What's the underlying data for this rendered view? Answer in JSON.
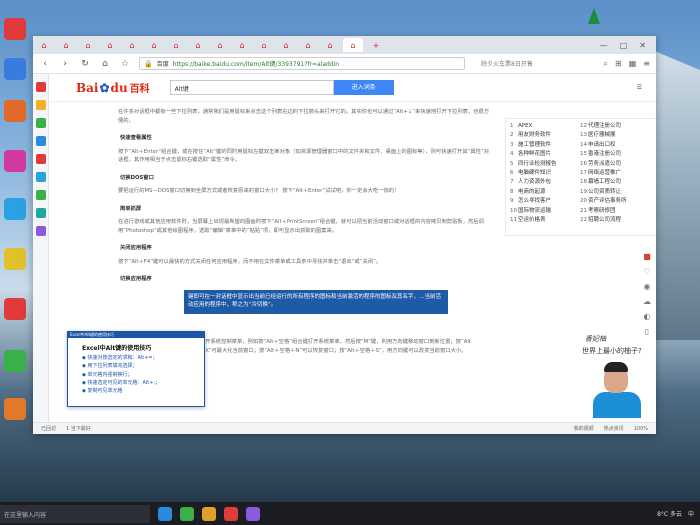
{
  "browser": {
    "tabs": [
      "",
      "",
      "",
      "",
      "",
      "",
      "",
      "",
      "",
      "",
      "",
      "",
      "",
      "",
      "",
      "",
      ""
    ],
    "new_tab": "+",
    "url_prefix": "百度",
    "url": "https://baike.baidu.com/item/Alt键/3393791?fr=aladdin",
    "recommend_text": "除夕火车票8日开售",
    "window_controls": [
      "—",
      "□",
      "✕"
    ]
  },
  "baike": {
    "logo_text": "Bai",
    "logo_paw": "du",
    "logo_suffix": "百科",
    "search_value": "Alt键",
    "search_button": "进入词条",
    "user_icon": "☰"
  },
  "article": {
    "p1": "在许多对话框中都有一些下拉列表，通常我们是用鼠标来点击这个列表右边的下拉箭头来打开它的。其实你也可以通过“Alt+↓”来快速地打开下拉列表，也很方便的。",
    "h1": "快速查看属性",
    "p2": "按下“Alt＋Enter”组合键，或在按住“Alt”键的同时用鼠标左键双击某对象（如资源管理器窗口中的文件夹和文件、桌面上的图标等），则可快速打开其“属性”对话框，其作用相当于点击鼠标右键选取“属性”命令。",
    "h2": "切换DOS窗口",
    "p3": "要把运行的MS－DOS窗口切换到全屏方式或者恢复原来的窗口大小？ 按下“Alt＋Enter”试试吧，你一定会大吃一惊的！",
    "h3": "简单抓屏",
    "p4": "在进行游戏或其他应用软件时，当屏幕上出现最希望的图画时按下“Alt＋PrintScreen”组合键，就可以把当前活动窗口或对话框的内容拷贝到剪贴板，然后调用“Photoshop”或其他绘图程序，选取“编辑”菜单中的“粘贴”项，即可显示出抓取的图案来。",
    "h4": "关闭应用程序",
    "p5": "按下“Alt＋F4”键可以最快的方式关闭任何应用程序，而不用在文件菜单或工具条中寻找并单击“退出”或“关闭”。",
    "h5": "切换应用程序",
    "p6_highlight": "键即可在一对话框中显示出当前已经运行的所有程序的图标和当前激活的程序的图标及其名字，…当前活动应用的程序中，称之为“冷切换”。",
    "p7": "以直接打开系统控制菜单，例如按“Alt＋空格”组合键打开系统菜单，然后按“M”键，利用方向键移动窗口到新位置；按“Alt＋空格＋X”可最大化当前窗口；按“Alt＋空格＋N”可以恢复窗口；按“Alt＋空格＋S”，用方向键可以改变当前窗口大小。"
  },
  "sidebar": {
    "items": [
      {
        "num": "1",
        "label": "APEX"
      },
      {
        "num": "12",
        "label": "代理注册公司"
      },
      {
        "num": "2",
        "label": "用友财务软件"
      },
      {
        "num": "13",
        "label": "医疗器械展"
      },
      {
        "num": "3",
        "label": "施工管理软件"
      },
      {
        "num": "14",
        "label": "申请出口权"
      },
      {
        "num": "4",
        "label": "各种鲜花图片"
      },
      {
        "num": "15",
        "label": "香港注册公司"
      },
      {
        "num": "5",
        "label": "同行业检测报告"
      },
      {
        "num": "16",
        "label": "劳务派遣公司"
      },
      {
        "num": "6",
        "label": "电脑硬件知识"
      },
      {
        "num": "17",
        "label": "网络运营推广"
      },
      {
        "num": "7",
        "label": "人力资源外包"
      },
      {
        "num": "18",
        "label": "幕墙工程公司"
      },
      {
        "num": "8",
        "label": "电商的起源"
      },
      {
        "num": "19",
        "label": "公司资质转让"
      },
      {
        "num": "9",
        "label": "怎么寻找客户"
      },
      {
        "num": "20",
        "label": "资产评估事务所"
      },
      {
        "num": "10",
        "label": "国际物流运输"
      },
      {
        "num": "21",
        "label": "考察研修团"
      },
      {
        "num": "11",
        "label": "空运价格表"
      },
      {
        "num": "22",
        "label": "招聘公司流程"
      }
    ]
  },
  "popup": {
    "bar": "Excel中Alt键的使用技巧",
    "title": "Excel中Alt键的使用技巧",
    "items": [
      "快速对按选定的求和：Alt+=；",
      "用下拉列表填充选择；",
      "单元格内强制换行；",
      "快速选定可见的单元格：Alt+;；",
      "复制可见单元格"
    ]
  },
  "presenter": {
    "name": "香妃柚",
    "subtitle": "世界上最小的柚子?"
  },
  "statusbar": {
    "items": [
      "已回访",
      "1 当下最好"
    ],
    "right_items": [
      "我的视频",
      "热点资讯",
      "",
      "100%"
    ]
  },
  "taskbar": {
    "search_placeholder": "在这里输入内容",
    "weather": "8°C 多云",
    "lang": "中"
  },
  "colors": {
    "baidu_blue": "#3f87f5",
    "baidu_red": "#de2910",
    "highlight": "#1f5aa6"
  }
}
